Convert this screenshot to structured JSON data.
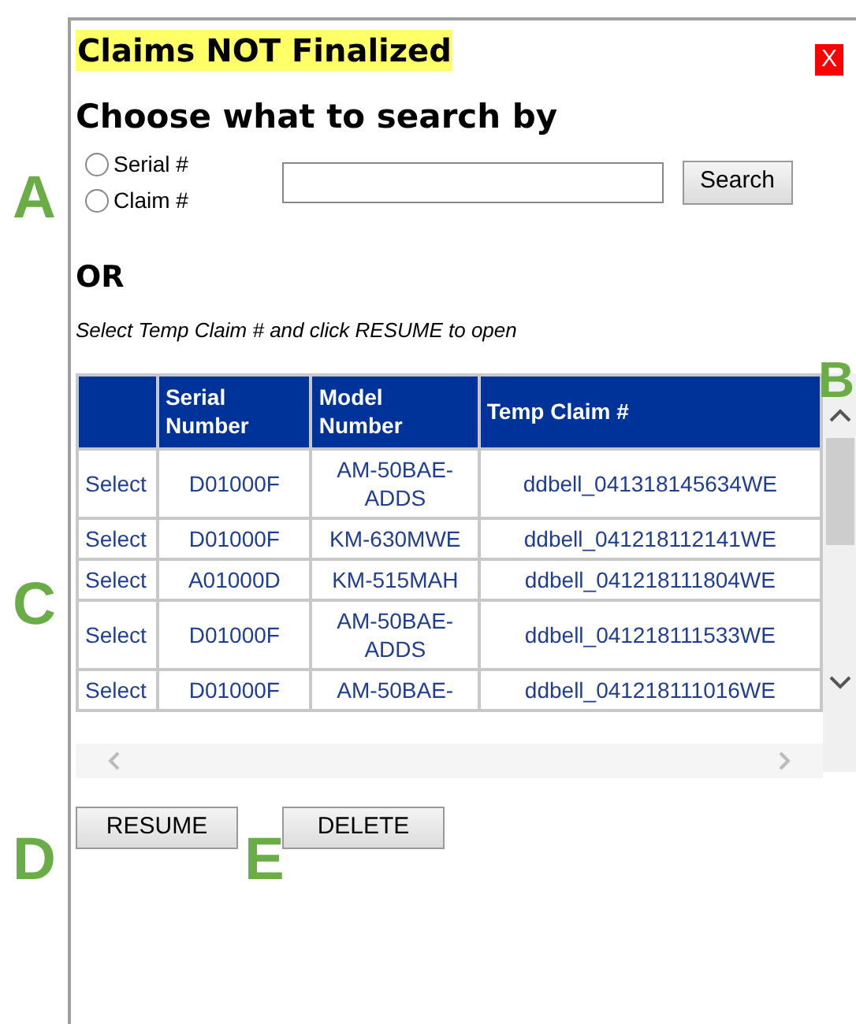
{
  "title": "Claims NOT Finalized",
  "close": "X",
  "heading": "Choose what to search by",
  "search_options": [
    {
      "label": "Serial #",
      "selected": false
    },
    {
      "label": "Claim #",
      "selected": false
    }
  ],
  "search_button": "Search",
  "or": "OR",
  "instruction": "Select Temp Claim # and click RESUME to open",
  "table": {
    "columns": [
      "",
      "Serial Number",
      "Model Number",
      "Temp Claim #"
    ],
    "rows": [
      {
        "link": "Select",
        "serial": "D01000F",
        "model": "AM-50BAE-ADDS",
        "claim": "ddbell_041318145634WE"
      },
      {
        "link": "Select",
        "serial": "D01000F",
        "model": "KM-630MWE",
        "claim": "ddbell_041218112141WE"
      },
      {
        "link": "Select",
        "serial": "A01000D",
        "model": "KM-515MAH",
        "claim": "ddbell_041218111804WE"
      },
      {
        "link": "Select",
        "serial": "D01000F",
        "model": "AM-50BAE-ADDS",
        "claim": "ddbell_041218111533WE"
      },
      {
        "link": "Select",
        "serial": "D01000F",
        "model": "AM-50BAE-",
        "claim": "ddbell_041218111016WE"
      }
    ]
  },
  "buttons": [
    "RESUME",
    "DELETE"
  ],
  "callouts": [
    "A",
    "B",
    "C",
    "D",
    "E"
  ]
}
